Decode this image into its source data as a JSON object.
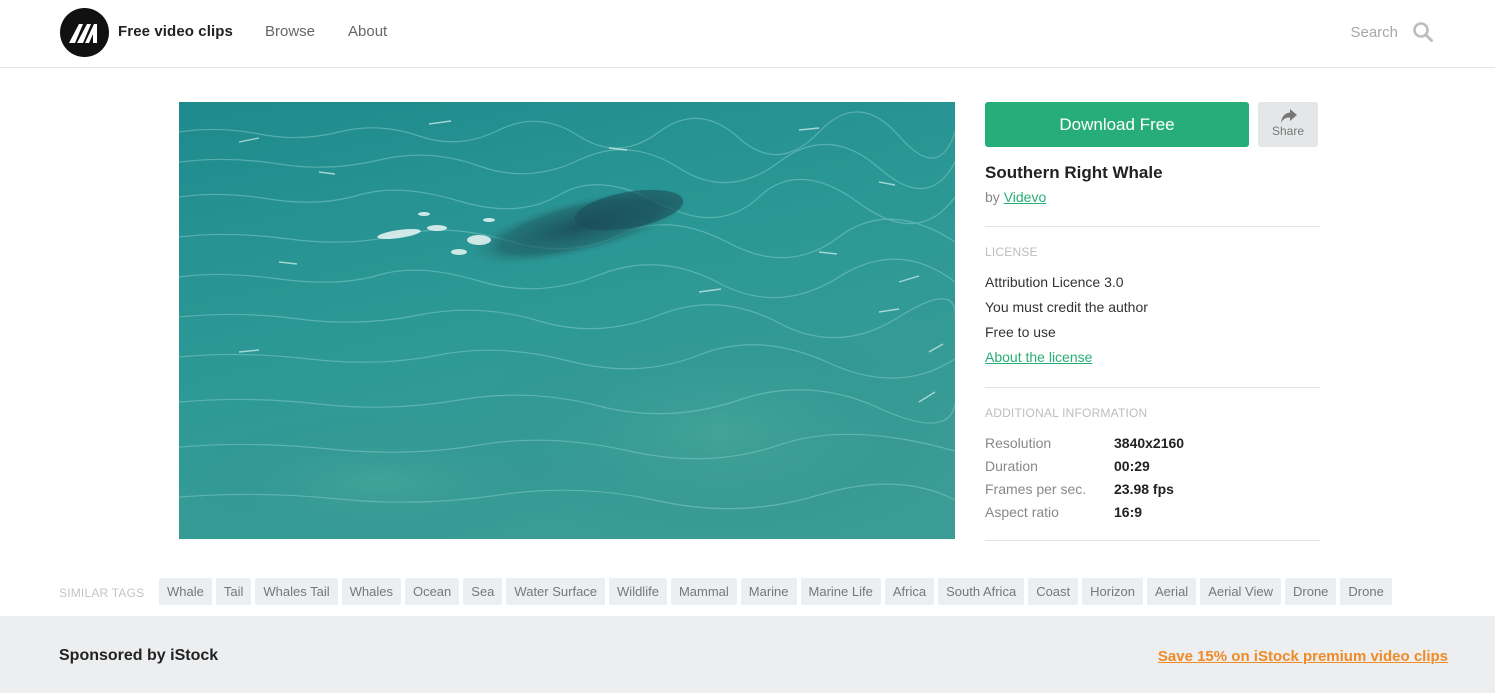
{
  "header": {
    "brand": "Free video clips",
    "nav": [
      {
        "label": "Browse"
      },
      {
        "label": "About"
      }
    ],
    "search": {
      "placeholder": "Search",
      "icon": "search-icon"
    }
  },
  "clip": {
    "title": "Southern Right Whale",
    "by_prefix": "by",
    "author": "Videvo"
  },
  "actions": {
    "download_label": "Download Free",
    "share_label": "Share",
    "download_color": "#27ae78"
  },
  "license": {
    "heading": "LICENSE",
    "lines": [
      "Attribution Licence 3.0",
      "You must credit the author",
      "Free to use"
    ],
    "link": "About the license"
  },
  "additional_info": {
    "heading": "ADDITIONAL INFORMATION",
    "rows": [
      {
        "key": "Resolution",
        "value": "3840x2160"
      },
      {
        "key": "Duration",
        "value": "00:29"
      },
      {
        "key": "Frames per sec.",
        "value": "23.98 fps"
      },
      {
        "key": "Aspect ratio",
        "value": "16:9"
      }
    ]
  },
  "similar_tags": {
    "label": "SIMILAR TAGS",
    "tags": [
      "Whale",
      "Tail",
      "Whales Tail",
      "Whales",
      "Ocean",
      "Sea",
      "Water Surface",
      "Wildlife",
      "Mammal",
      "Marine",
      "Marine Life",
      "Africa",
      "South Africa",
      "Coast",
      "Horizon",
      "Aerial",
      "Aerial View",
      "Drone",
      "Drone"
    ]
  },
  "sponsor": {
    "title": "Sponsored by iStock",
    "link": "Save 15% on iStock premium video clips",
    "link_color": "#f08a24"
  }
}
